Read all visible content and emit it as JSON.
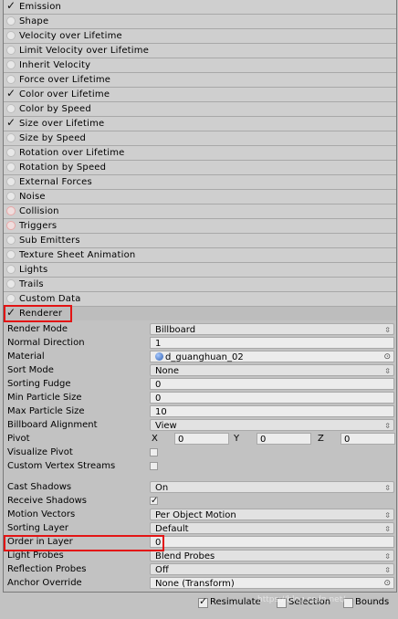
{
  "modules": [
    {
      "label": "Emission",
      "enabled": true
    },
    {
      "label": "Shape",
      "enabled": false
    },
    {
      "label": "Velocity over Lifetime",
      "enabled": false
    },
    {
      "label": "Limit Velocity over Lifetime",
      "enabled": false
    },
    {
      "label": "Inherit Velocity",
      "enabled": false
    },
    {
      "label": "Force over Lifetime",
      "enabled": false
    },
    {
      "label": "Color over Lifetime",
      "enabled": true
    },
    {
      "label": "Color by Speed",
      "enabled": false
    },
    {
      "label": "Size over Lifetime",
      "enabled": true
    },
    {
      "label": "Size by Speed",
      "enabled": false
    },
    {
      "label": "Rotation over Lifetime",
      "enabled": false
    },
    {
      "label": "Rotation by Speed",
      "enabled": false
    },
    {
      "label": "External Forces",
      "enabled": false
    },
    {
      "label": "Noise",
      "enabled": false
    },
    {
      "label": "Collision",
      "enabled": false
    },
    {
      "label": "Triggers",
      "enabled": false
    },
    {
      "label": "Sub Emitters",
      "enabled": false
    },
    {
      "label": "Texture Sheet Animation",
      "enabled": false
    },
    {
      "label": "Lights",
      "enabled": false
    },
    {
      "label": "Trails",
      "enabled": false
    },
    {
      "label": "Custom Data",
      "enabled": false
    },
    {
      "label": "Renderer",
      "enabled": true
    }
  ],
  "renderer": {
    "render_mode": {
      "label": "Render Mode",
      "value": "Billboard"
    },
    "normal_direction": {
      "label": "Normal Direction",
      "value": "1"
    },
    "material": {
      "label": "Material",
      "value": "d_guanghuan_02"
    },
    "sort_mode": {
      "label": "Sort Mode",
      "value": "None"
    },
    "sorting_fudge": {
      "label": "Sorting Fudge",
      "value": "0"
    },
    "min_particle_size": {
      "label": "Min Particle Size",
      "value": "0"
    },
    "max_particle_size": {
      "label": "Max Particle Size",
      "value": "10"
    },
    "billboard_alignment": {
      "label": "Billboard Alignment",
      "value": "View"
    },
    "pivot": {
      "label": "Pivot",
      "x_label": "X",
      "x": "0",
      "y_label": "Y",
      "y": "0",
      "z_label": "Z",
      "z": "0"
    },
    "visualize_pivot": {
      "label": "Visualize Pivot",
      "checked": false
    },
    "custom_vertex_streams": {
      "label": "Custom Vertex Streams",
      "checked": false
    },
    "cast_shadows": {
      "label": "Cast Shadows",
      "value": "On"
    },
    "receive_shadows": {
      "label": "Receive Shadows",
      "checked": true
    },
    "motion_vectors": {
      "label": "Motion Vectors",
      "value": "Per Object Motion"
    },
    "sorting_layer": {
      "label": "Sorting Layer",
      "value": "Default"
    },
    "order_in_layer": {
      "label": "Order in Layer",
      "value": "0"
    },
    "light_probes": {
      "label": "Light Probes",
      "value": "Blend Probes"
    },
    "reflection_probes": {
      "label": "Reflection Probes",
      "value": "Off"
    },
    "anchor_override": {
      "label": "Anchor Override",
      "value": "None (Transform)"
    }
  },
  "footer": {
    "resimulate": {
      "label": "Resimulate",
      "checked": true
    },
    "selection": {
      "label": "Selection",
      "checked": false
    },
    "bounds": {
      "label": "Bounds",
      "checked": false
    }
  },
  "watermark": "https://blog.csdn.net/",
  "colors": {
    "highlight": "#e31414",
    "panel": "#c2c2c2",
    "module_header": "#cfcfcf"
  }
}
